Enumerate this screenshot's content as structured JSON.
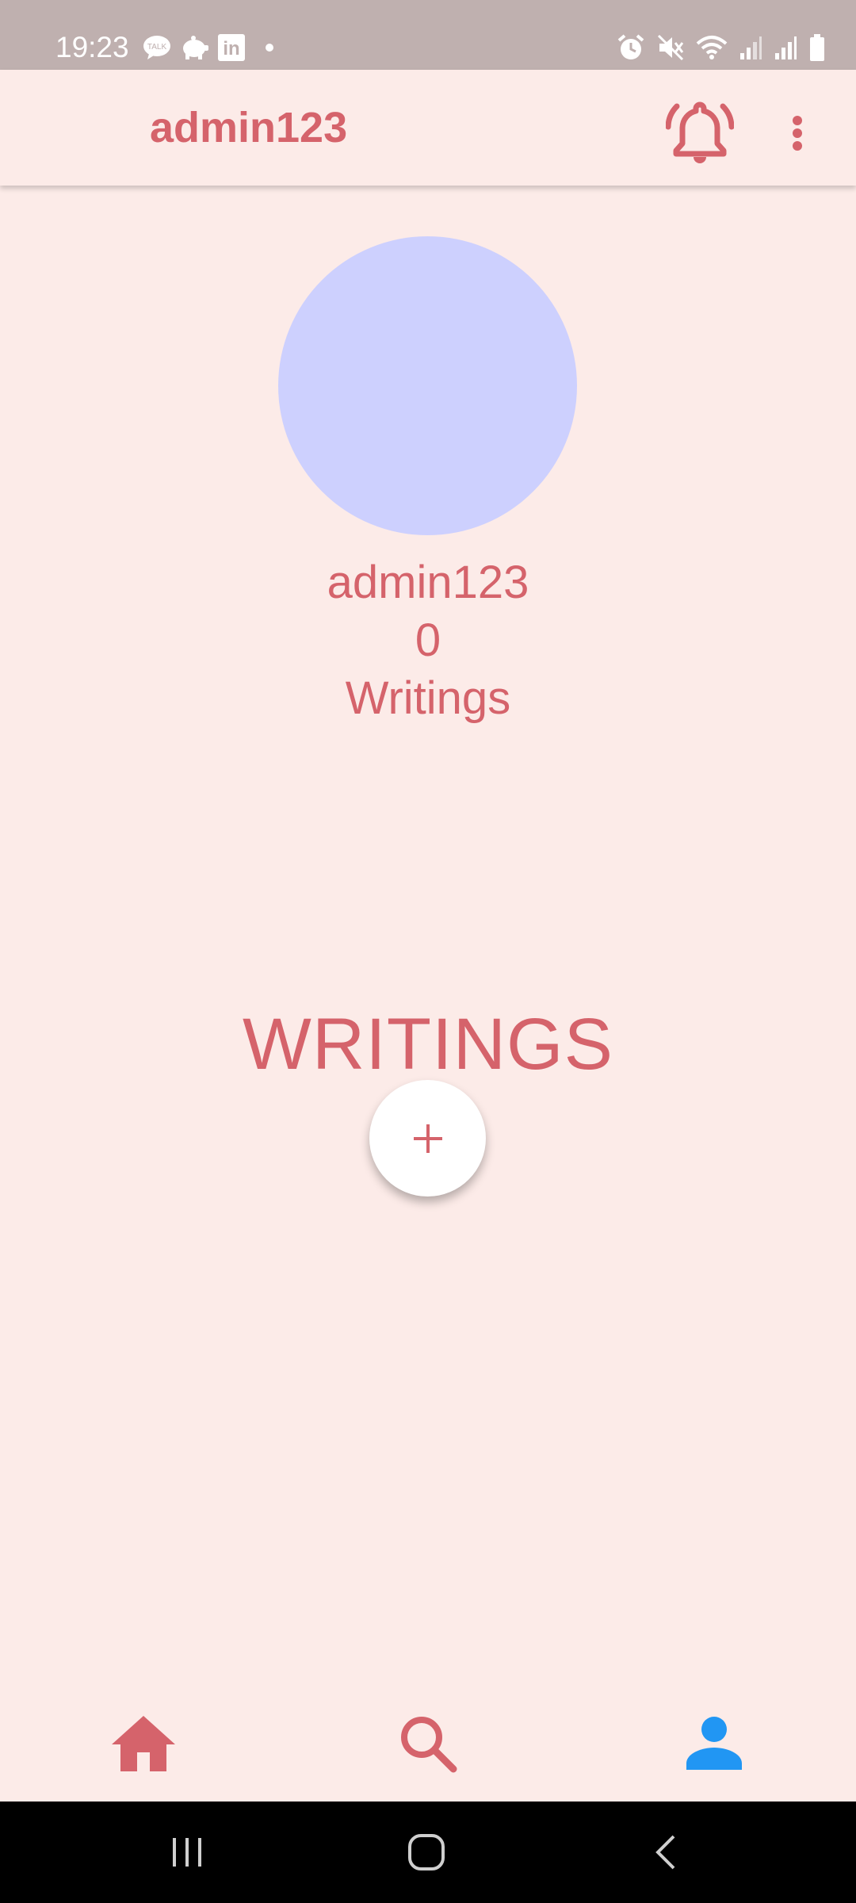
{
  "status_bar": {
    "time": "19:23",
    "left_icons": [
      "talk-icon",
      "piggy-bank-icon",
      "linkedin-icon",
      "dot-icon"
    ],
    "right_icons": [
      "alarm-icon",
      "mute-icon",
      "wifi-icon",
      "signal-icon",
      "signal-icon",
      "battery-icon"
    ],
    "talk_icon_text": "TALK",
    "linkedin_icon_text": "in"
  },
  "app_bar": {
    "title": "admin123",
    "actions": [
      "bell-icon",
      "more-vert-icon"
    ]
  },
  "profile": {
    "username": "admin123",
    "writings_count": "0",
    "writings_label": "Writings",
    "avatar_color": "#cdd0fe"
  },
  "writings_section": {
    "title": "WRITINGS",
    "add_icon": "plus-icon"
  },
  "bottom_nav": {
    "items": [
      {
        "icon": "home-icon",
        "active": false
      },
      {
        "icon": "search-icon",
        "active": false
      },
      {
        "icon": "person-icon",
        "active": true
      }
    ]
  },
  "system_nav": {
    "buttons": [
      "recents-icon",
      "home-icon",
      "back-icon"
    ]
  },
  "colors": {
    "accent": "#d5636b",
    "background": "#fcebe8",
    "active_nav": "#2196f3",
    "status_bar": "#bfb0af"
  }
}
